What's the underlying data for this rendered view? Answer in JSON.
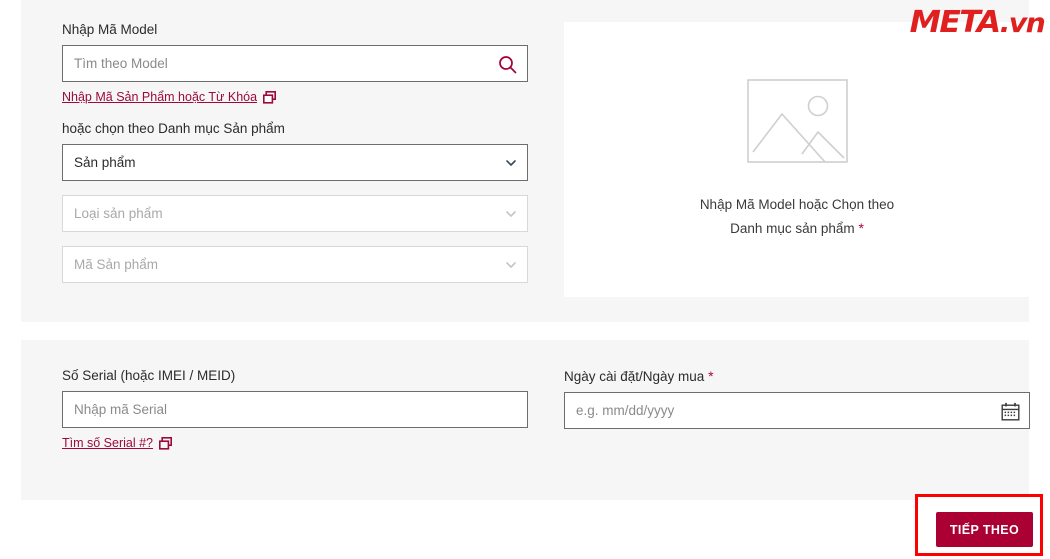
{
  "brand": {
    "name": "META",
    "suffix": ".vn",
    "color": "#e01f1f"
  },
  "model_section": {
    "label": "Nhập Mã Model",
    "search_placeholder": "Tìm theo Model",
    "search_value": "",
    "helper_link": "Nhập Mã Sản Phẩm hoặc Từ Khóa",
    "category_label": "hoặc chọn theo Danh mục Sản phẩm",
    "selects": [
      {
        "value": "Sản phẩm",
        "disabled": false
      },
      {
        "value": "Loại sản phẩm",
        "disabled": true
      },
      {
        "value": "Mã Sản phẩm",
        "disabled": true
      }
    ]
  },
  "preview": {
    "line1": "Nhập Mã Model hoặc Chọn theo",
    "line2": "Danh mục sản phẩm",
    "required_mark": "*"
  },
  "serial_section": {
    "label": "Số Serial (hoặc IMEI / MEID)",
    "placeholder": "Nhập mã Serial",
    "value": "",
    "helper_link": "Tìm số Serial #?"
  },
  "date_section": {
    "label": "Ngày cài đặt/Ngày mua",
    "required_mark": "*",
    "placeholder": "e.g. mm/dd/yyyy",
    "value": ""
  },
  "footer": {
    "next_label": "TIẾP THEO",
    "next_bg": "#aa0033",
    "annotation_color": "#ff0000"
  },
  "colors": {
    "card_bg": "#f6f6f6",
    "link": "#9b0a3c",
    "required": "#b3003c"
  }
}
